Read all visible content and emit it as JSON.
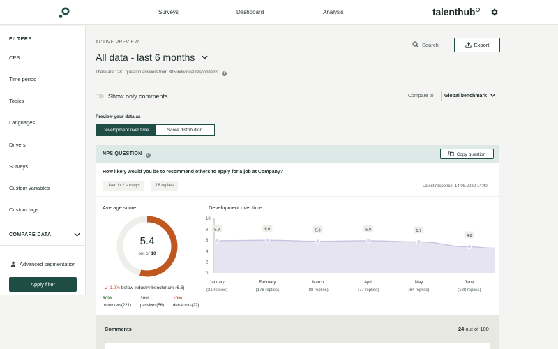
{
  "nav": {
    "surveys": "Surveys",
    "dashboard": "Dashboard",
    "analysis": "Analysis",
    "brand": "talenthub"
  },
  "sidebar": {
    "filters_title": "FILTERS",
    "items": [
      "CPS",
      "Time period",
      "Topics",
      "Languages",
      "Drivers",
      "Surveys",
      "Custom variables",
      "Custom tags"
    ],
    "compare_title": "COMPARE DATA",
    "advanced": "Advanced segmentation",
    "apply": "Apply filter"
  },
  "header": {
    "eyebrow": "ACTIVE PREVIEW",
    "title": "All data - last 6 months",
    "note": "There are 1281 question answers from 385 individual respondents",
    "search": "Search",
    "export": "Export"
  },
  "controls": {
    "toggle_label": "Show only comments",
    "compare_label": "Compare to",
    "compare_value": "Global benchmark",
    "preview_label": "Preview your data as",
    "seg_on": "Development over time",
    "seg_off": "Score distribution"
  },
  "nps": {
    "title": "NPS QUESTION",
    "copy": "Copy question",
    "question": "How likely would you be to recommend others to apply for a job at Company?",
    "tag_surveys": "Used in 2 surveys",
    "tag_replies": "18 replies",
    "latest": "Latest responce: 14.08.2022 14:40",
    "avg_label": "Average score",
    "score": "5.4",
    "score_out": "out of",
    "score_max": "10",
    "score_fraction": 0.54,
    "bench_delta": "1.2%",
    "bench_text": "below industry benchmark (6.6)",
    "promoters_pct": "60%",
    "promoters_lbl": "promoters(221)",
    "passives_pct": "30%",
    "passives_lbl": "passives(56)",
    "detractors_pct": "10%",
    "detractors_lbl": "detractors(22)",
    "dev_label": "Development over time"
  },
  "chart_data": {
    "type": "area",
    "title": "Development over time",
    "categories": [
      "January",
      "February",
      "March",
      "April",
      "May",
      "June"
    ],
    "replies": [
      "(21 replies)",
      "(178 replies)",
      "(88 replies)",
      "(77 replies)",
      "(84 replies)",
      "(188 replies)"
    ],
    "values": [
      5.9,
      6.0,
      5.8,
      5.9,
      5.7,
      4.8
    ],
    "labels": [
      "5.9",
      "6.0",
      "5.8",
      "5.9",
      "5.7",
      "4.8"
    ],
    "yticks": [
      "10",
      "8",
      "6",
      "4",
      "2",
      "0"
    ],
    "ylim": [
      0,
      10
    ]
  },
  "comments": {
    "title": "Comments",
    "count": "24",
    "count_suffix": "out of 100"
  },
  "colors": {
    "accent": "#1e4d45",
    "donut": "#c0571f",
    "area": "#e7e4f1",
    "line": "#c9c3e0"
  }
}
